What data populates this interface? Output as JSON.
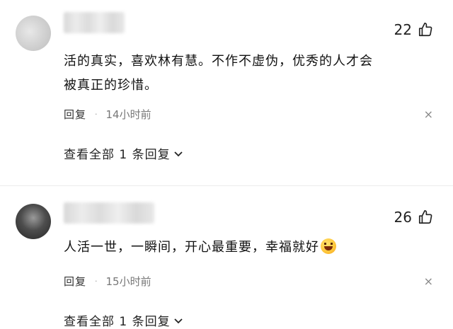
{
  "comments": [
    {
      "likes": "22",
      "text": "活的真实，喜欢林有慧。不作不虚伪，优秀的人才会被真正的珍惜。",
      "reply_label": "回复",
      "separator": "·",
      "time": "14小时前",
      "close": "×",
      "view_replies": "查看全部 1 条回复"
    },
    {
      "likes": "26",
      "text": "人活一世，一瞬间，开心最重要，幸福就好",
      "reply_label": "回复",
      "separator": "·",
      "time": "15小时前",
      "close": "×",
      "view_replies": "查看全部 1 条回复"
    }
  ],
  "icons": {
    "like": "thumbs-up-icon",
    "close": "close-icon",
    "expand": "chevron-down-icon",
    "emoji": "laughing-face-emoji"
  }
}
